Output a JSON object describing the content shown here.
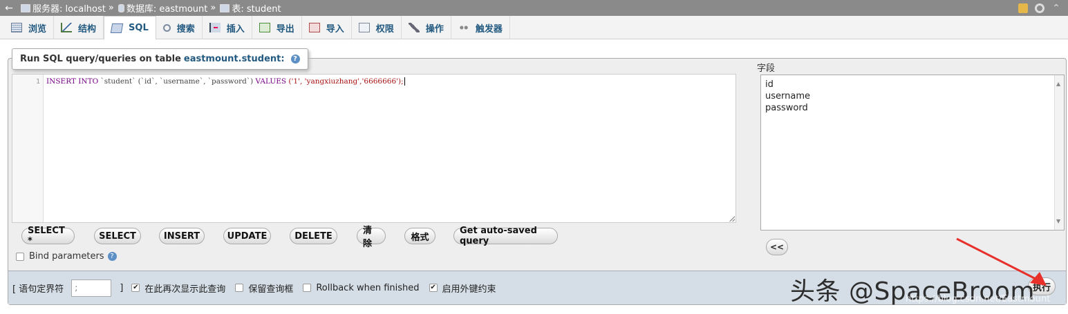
{
  "breadcrumb": {
    "back_icon": "←",
    "server_label": "服务器: localhost",
    "database_label": "数据库: eastmount",
    "table_label": "表: student",
    "separator": "»"
  },
  "tabs": [
    {
      "label": "浏览",
      "icon": "browse-icon"
    },
    {
      "label": "结构",
      "icon": "structure-icon"
    },
    {
      "label": "SQL",
      "icon": "sql-icon",
      "active": true
    },
    {
      "label": "搜索",
      "icon": "search-icon"
    },
    {
      "label": "插入",
      "icon": "insert-icon"
    },
    {
      "label": "导出",
      "icon": "export-icon"
    },
    {
      "label": "导入",
      "icon": "import-icon"
    },
    {
      "label": "权限",
      "icon": "privileges-icon"
    },
    {
      "label": "操作",
      "icon": "operations-icon"
    },
    {
      "label": "触发器",
      "icon": "triggers-icon"
    }
  ],
  "panel": {
    "title_prefix": "Run SQL query/queries on table",
    "table_name": "eastmount.student:",
    "help_glyph": "?"
  },
  "editor": {
    "line_number": "1",
    "sql": {
      "kw1": "INSERT INTO",
      "tbl": " `student` (`id`, `username`, `password`) ",
      "kw2": "VALUES",
      "vals": " ('1', 'yangxiuzhang','6666666');"
    }
  },
  "buttons": {
    "select_star": "SELECT *",
    "select": "SELECT",
    "insert": "INSERT",
    "update": "UPDATE",
    "delete": "DELETE",
    "clear": "清除",
    "format": "格式",
    "auto_saved": "Get auto-saved query"
  },
  "bind_parameters": {
    "label": "Bind parameters",
    "checked": false
  },
  "fields": {
    "label": "字段",
    "items": [
      "id",
      "username",
      "password"
    ],
    "insert_button": "<<"
  },
  "options": {
    "delimiter_label": "[ 语句定界符",
    "delimiter_value": ";",
    "delimiter_close": "]",
    "show_again": {
      "label": "在此再次显示此查询",
      "checked": true
    },
    "keep_box": {
      "label": "保留查询框",
      "checked": false
    },
    "rollback": {
      "label": "Rollback when finished",
      "checked": false
    },
    "foreign_keys": {
      "label": "启用外键约束",
      "checked": true
    },
    "go_button": "执行"
  },
  "overlay": {
    "watermark": "头条 @SpaceBroom",
    "url": "https://blog.csdn.net/Eastmount",
    "arrow_color": "#e8302a"
  }
}
